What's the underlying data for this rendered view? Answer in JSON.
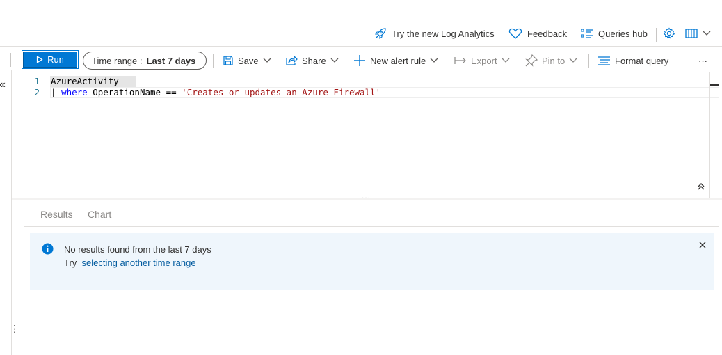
{
  "top_bar": {
    "try_new": "Try the new Log Analytics",
    "feedback": "Feedback",
    "queries_hub": "Queries hub"
  },
  "toolbar": {
    "run": "Run",
    "time_range_label": "Time range :",
    "time_range_value": "Last 7 days",
    "save": "Save",
    "share": "Share",
    "new_alert_rule": "New alert rule",
    "export": "Export",
    "pin_to": "Pin to",
    "format_query": "Format query",
    "more": "···"
  },
  "editor": {
    "lines": [
      {
        "number": "1",
        "text": "AzureActivity"
      },
      {
        "number": "2",
        "pipe": "| ",
        "keyword": "where",
        "field": " OperationName == ",
        "string": "'Creates or updates an Azure Firewall'"
      }
    ],
    "splitter_dots": "···",
    "collapse_left": "«"
  },
  "results": {
    "tabs": [
      "Results",
      "Chart"
    ],
    "message": "No results found from the last 7 days",
    "try_prefix": "Try",
    "link_text": "selecting another time range"
  },
  "colors": {
    "accent": "#0078d4",
    "info_bg": "#eff6fc",
    "keyword": "#0000ff",
    "string": "#a31515"
  }
}
